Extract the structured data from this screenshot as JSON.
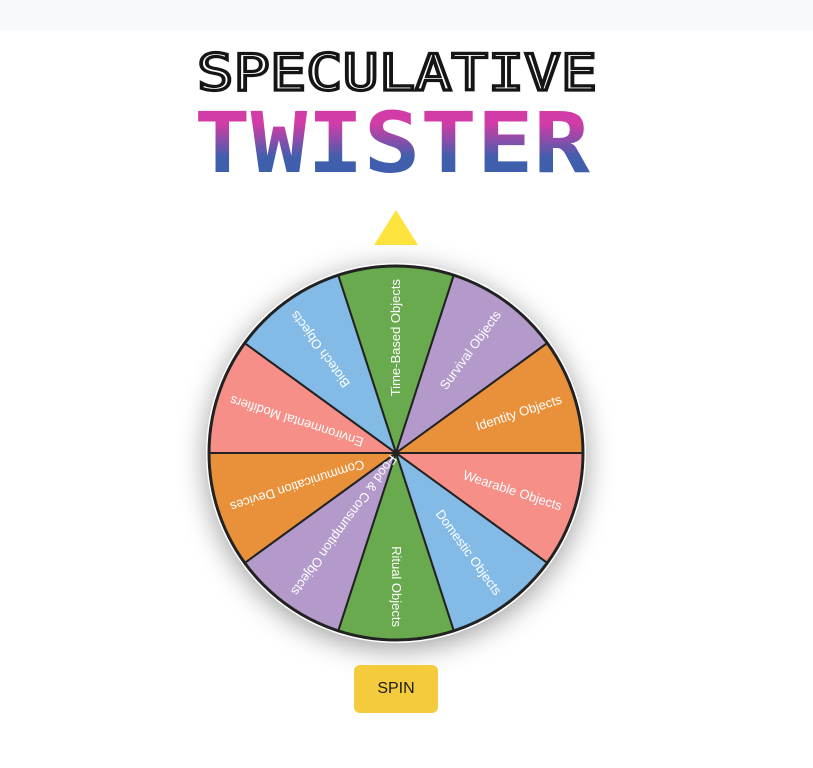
{
  "title": {
    "line1": "SPECULATIVE",
    "line2": "TWISTER",
    "line1_color": "#151515",
    "gradient_top": "#d23ca6",
    "gradient_bottom": "#3f5fad"
  },
  "pointer": {
    "icon": "triangle-down-pointer-icon",
    "color": "#fde43f"
  },
  "wheel": {
    "border_color": "#222222",
    "segments": [
      {
        "label": "Time-Based Objects",
        "color": "#6aaa4e"
      },
      {
        "label": "Survival Objects",
        "color": "#b39acb"
      },
      {
        "label": "Identity Objects",
        "color": "#e8913a"
      },
      {
        "label": "Wearable Objects",
        "color": "#f58f87"
      },
      {
        "label": "Domestic Objects",
        "color": "#84bbe6"
      },
      {
        "label": "Ritual Objects",
        "color": "#6aaa4e"
      },
      {
        "label": "Food & Consumption Objects",
        "color": "#b39acb"
      },
      {
        "label": "Communication Devices",
        "color": "#e8913a"
      },
      {
        "label": "Environmental Modifiers",
        "color": "#f58f87"
      },
      {
        "label": "Biotech Objects",
        "color": "#84bbe6"
      }
    ]
  },
  "spin": {
    "label": "SPIN"
  }
}
